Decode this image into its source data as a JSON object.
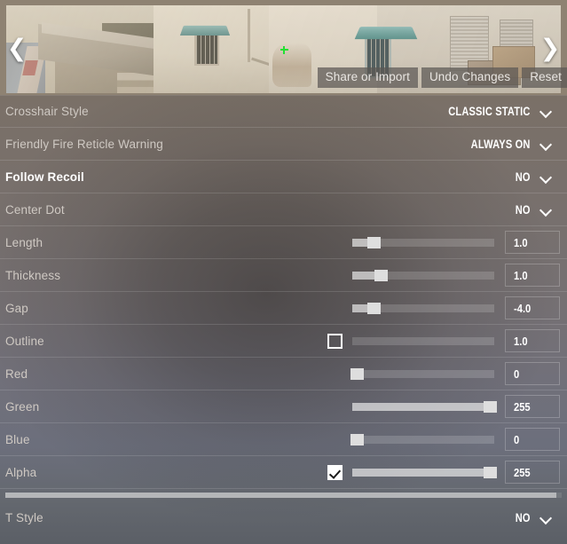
{
  "preview": {
    "nav_prev_icon": "chevron-left-icon",
    "nav_next_icon": "chevron-right-icon",
    "crosshair_color": "#22e032",
    "actions": [
      {
        "label": "Share or Import"
      },
      {
        "label": "Undo Changes"
      },
      {
        "label": "Reset"
      }
    ]
  },
  "settings": {
    "rows": [
      {
        "name": "crosshair-style",
        "label": "Crosshair Style",
        "type": "dropdown",
        "value": "CLASSIC STATIC",
        "highlight": false
      },
      {
        "name": "friendly-fire-reticle-warning",
        "label": "Friendly Fire Reticle Warning",
        "type": "dropdown",
        "value": "ALWAYS ON",
        "highlight": false
      },
      {
        "name": "follow-recoil",
        "label": "Follow Recoil",
        "type": "dropdown",
        "value": "NO",
        "highlight": true
      },
      {
        "name": "center-dot",
        "label": "Center Dot",
        "type": "dropdown",
        "value": "NO",
        "highlight": false
      },
      {
        "name": "length",
        "label": "Length",
        "type": "slider",
        "value": "1.0",
        "fill_pct": 15,
        "knob_pct": 15,
        "checkbox": null,
        "highlight": false
      },
      {
        "name": "thickness",
        "label": "Thickness",
        "type": "slider",
        "value": "1.0",
        "fill_pct": 20,
        "knob_pct": 20,
        "checkbox": null,
        "highlight": false
      },
      {
        "name": "gap",
        "label": "Gap",
        "type": "slider",
        "value": "-4.0",
        "fill_pct": 15,
        "knob_pct": 15,
        "checkbox": null,
        "highlight": false
      },
      {
        "name": "outline",
        "label": "Outline",
        "type": "slider",
        "value": "1.0",
        "fill_pct": 0,
        "knob_pct": 0,
        "checkbox": false,
        "highlight": false
      },
      {
        "name": "red",
        "label": "Red",
        "type": "slider",
        "value": "0",
        "fill_pct": 0,
        "knob_pct": 3,
        "checkbox": null,
        "highlight": false
      },
      {
        "name": "green",
        "label": "Green",
        "type": "slider",
        "value": "255",
        "fill_pct": 97,
        "knob_pct": 97,
        "checkbox": null,
        "highlight": false
      },
      {
        "name": "blue",
        "label": "Blue",
        "type": "slider",
        "value": "0",
        "fill_pct": 0,
        "knob_pct": 3,
        "checkbox": null,
        "highlight": false
      },
      {
        "name": "alpha",
        "label": "Alpha",
        "type": "slider",
        "value": "255",
        "fill_pct": 97,
        "knob_pct": 97,
        "checkbox": true,
        "highlight": false
      }
    ],
    "scrollbar_thumb_pct": 99,
    "footer_row": {
      "name": "t-style",
      "label": "T Style",
      "type": "dropdown",
      "value": "NO",
      "highlight": false
    }
  }
}
